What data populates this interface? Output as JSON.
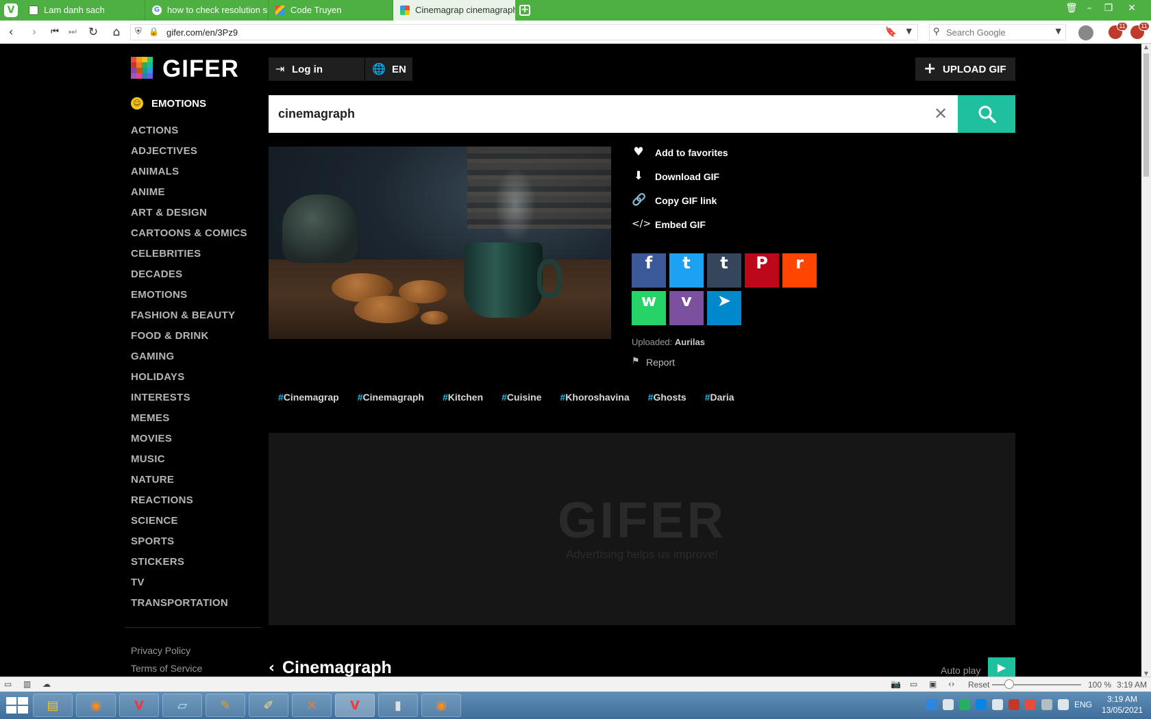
{
  "browser": {
    "tabs": [
      {
        "title": "Lam danh sach",
        "icon": "page-icon"
      },
      {
        "title": "how to check resolution size",
        "icon": "google-icon"
      },
      {
        "title": "Code Truyen",
        "icon": "image-icon"
      },
      {
        "title": "Cinemagrap cinemagraph Kitchen",
        "icon": "gifer-icon"
      }
    ],
    "url": "gifer.com/en/3Pz9",
    "search_placeholder": "Search Google",
    "extension_badges": [
      "11",
      "11"
    ]
  },
  "site": {
    "logo_text": "GIFER",
    "login_label": "Log in",
    "lang_label": "EN",
    "upload_label": "UPLOAD GIF",
    "sidebar_heading": "EMOTIONS",
    "categories": [
      "ACTIONS",
      "ADJECTIVES",
      "ANIMALS",
      "ANIME",
      "ART & DESIGN",
      "CARTOONS & COMICS",
      "CELEBRITIES",
      "DECADES",
      "EMOTIONS",
      "FASHION & BEAUTY",
      "FOOD & DRINK",
      "GAMING",
      "HOLIDAYS",
      "INTERESTS",
      "MEMES",
      "MOVIES",
      "MUSIC",
      "NATURE",
      "REACTIONS",
      "SCIENCE",
      "SPORTS",
      "STICKERS",
      "TV",
      "TRANSPORTATION"
    ],
    "footer_links": [
      "Privacy Policy",
      "Terms of Service"
    ],
    "search_value": "cinemagraph",
    "accent_color": "#1ec0a0"
  },
  "gif": {
    "actions": [
      "Add to favorites",
      "Download GIF",
      "Copy GIF link",
      "Embed GIF"
    ],
    "share": [
      {
        "name": "facebook",
        "glyph": "f",
        "color": "#3b5998"
      },
      {
        "name": "twitter",
        "glyph": "t",
        "color": "#1da1f2"
      },
      {
        "name": "tumblr",
        "glyph": "t",
        "color": "#35465c"
      },
      {
        "name": "pinterest",
        "glyph": "P",
        "color": "#bd081c"
      },
      {
        "name": "reddit",
        "glyph": "r",
        "color": "#ff4500"
      },
      {
        "name": "whatsapp",
        "glyph": "w",
        "color": "#25d366"
      },
      {
        "name": "viber",
        "glyph": "v",
        "color": "#7b519d"
      },
      {
        "name": "telegram",
        "glyph": "➤",
        "color": "#0088cc"
      }
    ],
    "uploaded_label": "Uploaded:",
    "uploader": "Aurilas",
    "report_label": "Report",
    "tags": [
      "Cinemagrap",
      "Cinemagraph",
      "Kitchen",
      "Cuisine",
      "Khoroshavina",
      "Ghosts",
      "Daria"
    ]
  },
  "ad": {
    "logo": "GIFER",
    "tagline": "Advertising helps us improve!"
  },
  "section": {
    "title": "Cinemagraph",
    "autoplay_label": "Auto play"
  },
  "statusbar": {
    "reset_label": "Reset",
    "zoom": "100 %",
    "time": "3:19 AM"
  },
  "taskbar": {
    "lang": "ENG",
    "time": "3:19 AM",
    "date": "13/05/2021"
  }
}
